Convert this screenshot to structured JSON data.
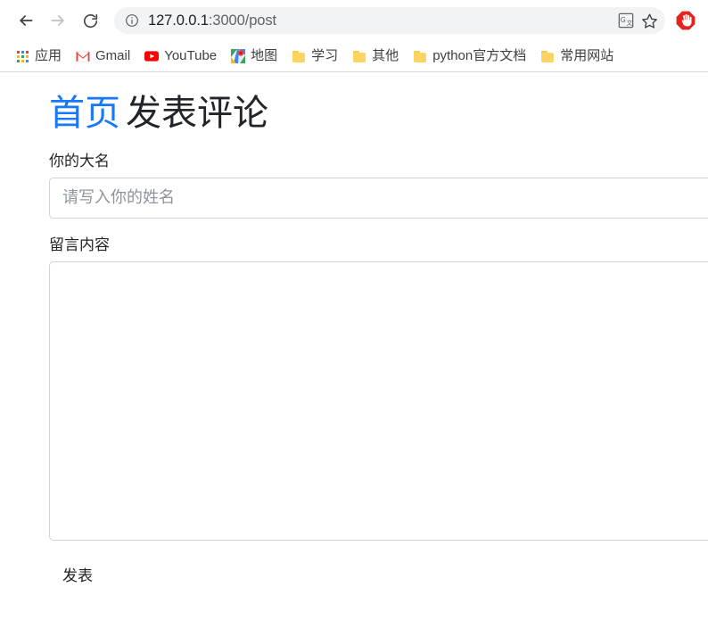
{
  "browser": {
    "nav": {
      "back_label": "Back",
      "forward_label": "Forward",
      "reload_label": "Reload"
    },
    "omnibox": {
      "site_info_icon": "info-circle-icon",
      "url_host": "127.0.0.1",
      "url_rest": ":3000/post",
      "url_full": "127.0.0.1:3000/post",
      "translate_icon": "translate-icon",
      "bookmark_icon": "star-icon"
    },
    "extension": {
      "name": "adblock-extension-icon",
      "color": "#e32222"
    },
    "bookmarks": [
      {
        "label": "应用",
        "icon": "apps-grid-icon"
      },
      {
        "label": "Gmail",
        "icon": "gmail-icon"
      },
      {
        "label": "YouTube",
        "icon": "youtube-icon"
      },
      {
        "label": "地图",
        "icon": "google-maps-icon"
      },
      {
        "label": "学习",
        "icon": "folder-icon"
      },
      {
        "label": "其他",
        "icon": "folder-icon"
      },
      {
        "label": "python官方文档",
        "icon": "folder-icon"
      },
      {
        "label": "常用网站",
        "icon": "folder-icon"
      }
    ]
  },
  "page": {
    "heading": {
      "home_link": "首页",
      "rest": "发表评论"
    },
    "form": {
      "name_label": "你的大名",
      "name_value": "",
      "name_placeholder": "请写入你的姓名",
      "content_label": "留言内容",
      "content_value": "",
      "content_placeholder": "",
      "submit_label": "发表"
    }
  },
  "colors": {
    "link_blue": "#1677ff",
    "text_dark": "#212529",
    "border_gray": "#ced4da",
    "placeholder_gray": "#8d949c",
    "chrome_omnibox_bg": "#f1f3f4"
  }
}
